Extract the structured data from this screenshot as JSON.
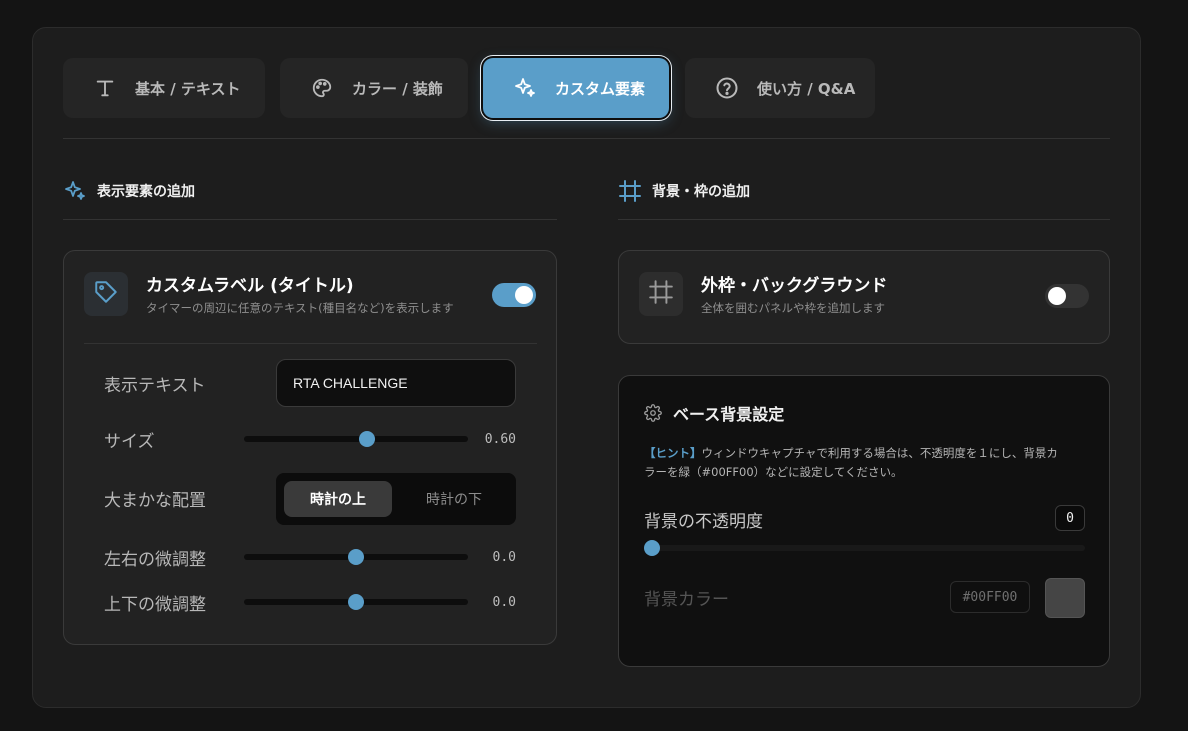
{
  "tabs": [
    {
      "label": "基本 / テキスト",
      "icon": "text-icon"
    },
    {
      "label": "カラー / 装飾",
      "icon": "palette-icon"
    },
    {
      "label": "カスタム要素",
      "icon": "sparkles-icon"
    },
    {
      "label": "使い方 / Q&A",
      "icon": "help-icon"
    }
  ],
  "left_section": {
    "title": "表示要素の追加",
    "custom_label": {
      "title": "カスタムラベル (タイトル)",
      "subtitle": "タイマーの周辺に任意のテキスト(種目名など)を表示します",
      "enabled": true,
      "text_label": "表示テキスト",
      "text_value": "RTA CHALLENGE",
      "size_label": "サイズ",
      "size_value": "0.60",
      "size_level": 0.55,
      "placement_label": "大まかな配置",
      "placement_options": [
        "時計の上",
        "時計の下"
      ],
      "placement_selected": "時計の上",
      "offset_x_label": "左右の微調整",
      "offset_x_value": "0.0",
      "offset_x_level": 0.5,
      "offset_y_label": "上下の微調整",
      "offset_y_value": "0.0",
      "offset_y_level": 0.5
    }
  },
  "right_section": {
    "title": "背景・枠の追加",
    "frame": {
      "title": "外枠・バックグラウンド",
      "subtitle": "全体を囲むパネルや枠を追加します",
      "enabled": false
    },
    "base_bg": {
      "title": "ベース背景設定",
      "hint_tag": "【ヒント】",
      "hint_line1": "ウィンドウキャプチャで利用する場合は、不透明度を１にし、背景カ",
      "hint_line2": "ラーを緑（#00FF00）などに設定してください。",
      "opacity_label": "背景の不透明度",
      "opacity_value": "0",
      "opacity_level": 0,
      "color_label": "背景カラー",
      "color_value": "#00FF00"
    }
  },
  "colors": {
    "accent": "#5a9ec9",
    "panel": "#1d1d1d",
    "card": "#222222"
  }
}
